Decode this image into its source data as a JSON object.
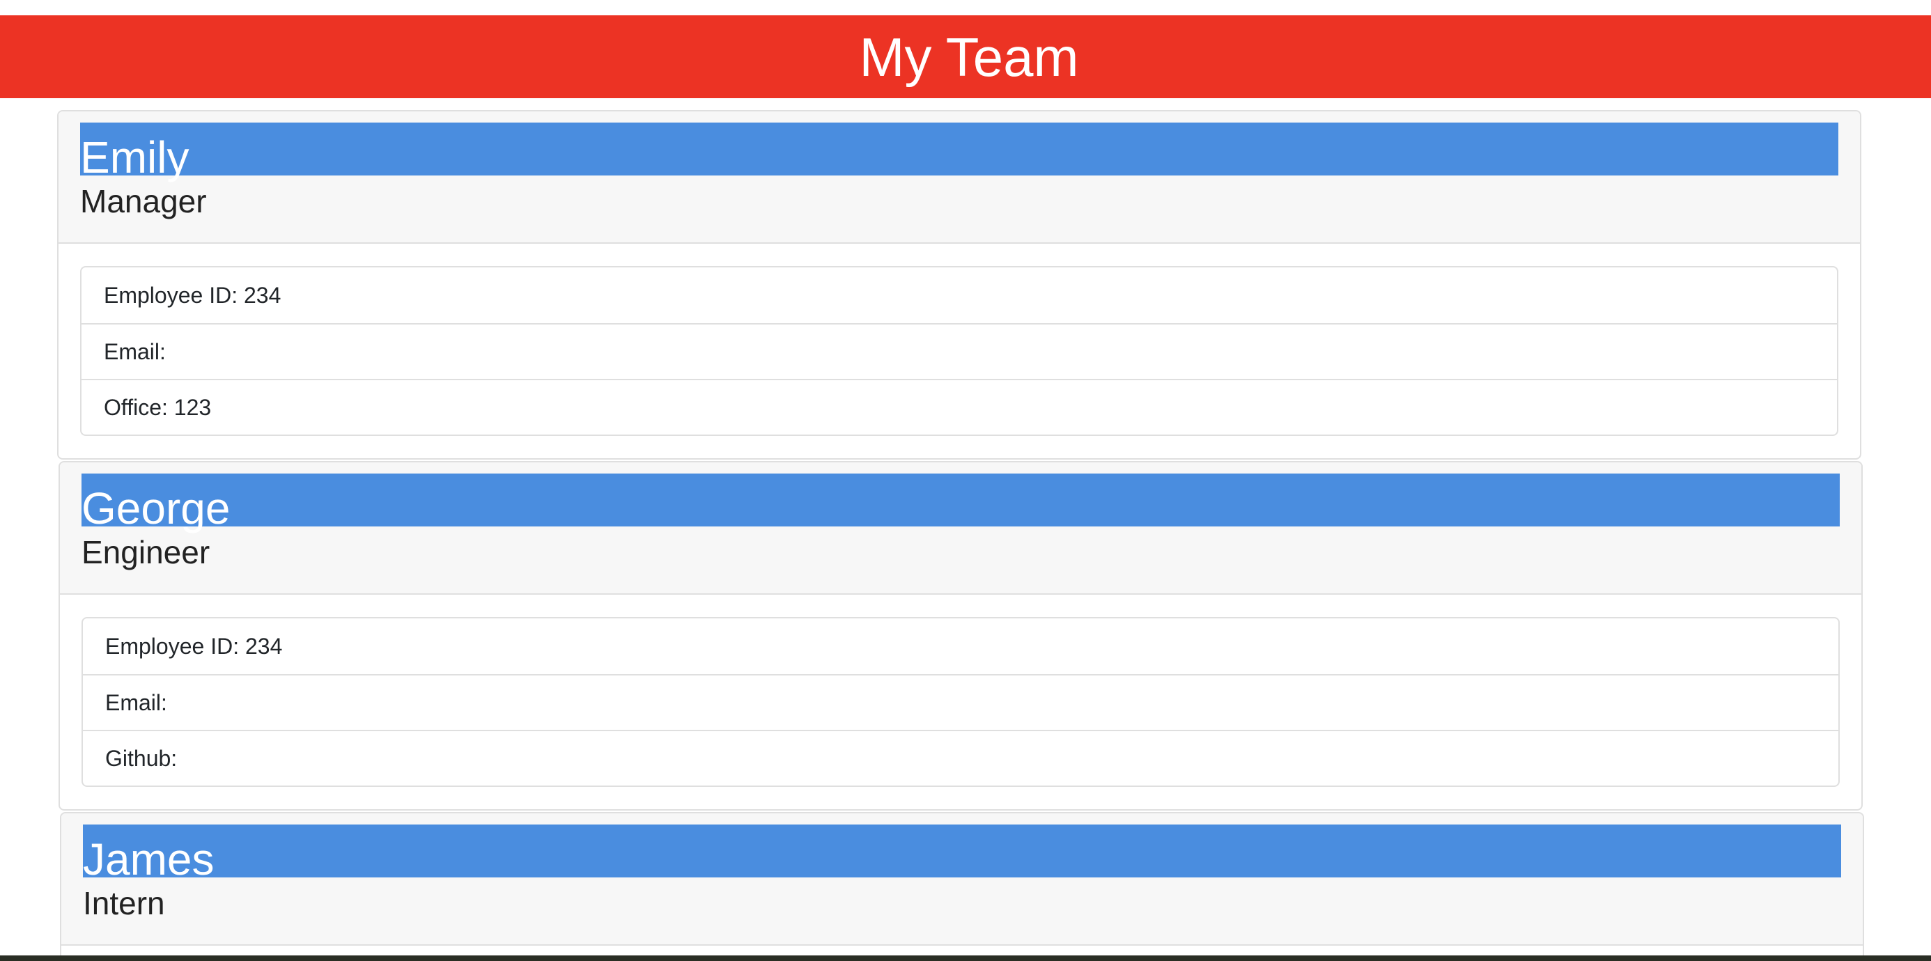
{
  "header": {
    "title": "My Team"
  },
  "employees": [
    {
      "name": "Emily",
      "role": "Manager",
      "details": [
        "Employee ID: 234",
        "Email:",
        "Office: 123"
      ]
    },
    {
      "name": "George",
      "role": "Engineer",
      "details": [
        "Employee ID: 234",
        "Email:",
        "Github:"
      ]
    },
    {
      "name": "James",
      "role": "Intern",
      "details": []
    }
  ],
  "colors": {
    "header_bg": "#ec3324",
    "name_bar_bg": "#4a8ddf",
    "card_header_bg": "#f7f7f7"
  }
}
